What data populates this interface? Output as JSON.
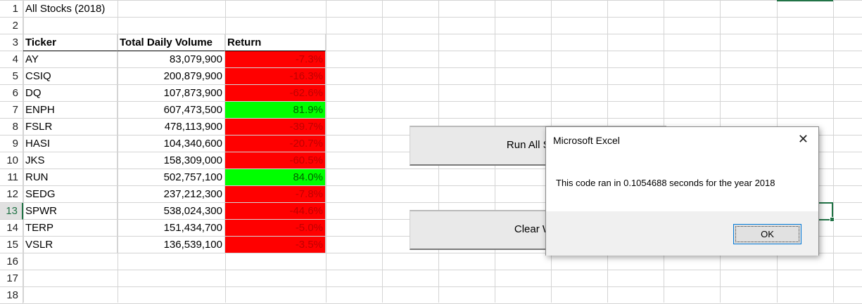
{
  "sheet": {
    "title": "All Stocks (2018)",
    "headers": {
      "ticker": "Ticker",
      "volume": "Total Daily Volume",
      "return": "Return"
    },
    "rows": [
      {
        "ticker": "AY",
        "volume": "83,079,900",
        "ret": "-7.3%",
        "status": "neg"
      },
      {
        "ticker": "CSIQ",
        "volume": "200,879,900",
        "ret": "-16.3%",
        "status": "neg"
      },
      {
        "ticker": "DQ",
        "volume": "107,873,900",
        "ret": "-62.6%",
        "status": "neg"
      },
      {
        "ticker": "ENPH",
        "volume": "607,473,500",
        "ret": "81.9%",
        "status": "pos"
      },
      {
        "ticker": "FSLR",
        "volume": "478,113,900",
        "ret": "-39.7%",
        "status": "neg"
      },
      {
        "ticker": "HASI",
        "volume": "104,340,600",
        "ret": "-20.7%",
        "status": "neg"
      },
      {
        "ticker": "JKS",
        "volume": "158,309,000",
        "ret": "-60.5%",
        "status": "neg"
      },
      {
        "ticker": "RUN",
        "volume": "502,757,100",
        "ret": "84.0%",
        "status": "pos"
      },
      {
        "ticker": "SEDG",
        "volume": "237,212,300",
        "ret": "-7.8%",
        "status": "neg"
      },
      {
        "ticker": "SPWR",
        "volume": "538,024,300",
        "ret": "-44.6%",
        "status": "neg"
      },
      {
        "ticker": "TERP",
        "volume": "151,434,700",
        "ret": "-5.0%",
        "status": "neg"
      },
      {
        "ticker": "VSLR",
        "volume": "136,539,100",
        "ret": "-3.5%",
        "status": "neg"
      }
    ],
    "row_numbers": [
      "1",
      "2",
      "3",
      "4",
      "5",
      "6",
      "7",
      "8",
      "9",
      "10",
      "11",
      "12",
      "13",
      "14",
      "15",
      "16",
      "17",
      "18"
    ],
    "selected_row": "13"
  },
  "buttons": {
    "run": "Run All Stock",
    "clear": "Clear Wor"
  },
  "dialog": {
    "title": "Microsoft Excel",
    "close": "✕",
    "message": "This code ran in 0.1054688 seconds for the year 2018",
    "ok": "OK"
  },
  "colors": {
    "negative_fill": "#ff0000",
    "positive_fill": "#00ff00",
    "selection": "#217346"
  }
}
